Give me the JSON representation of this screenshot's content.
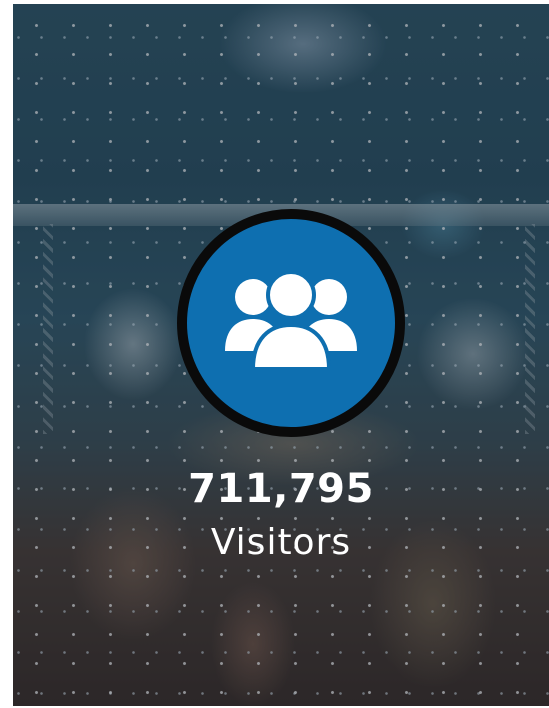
{
  "stat": {
    "value": "711,795",
    "label": "Visitors",
    "icon": "users-group-icon"
  },
  "colors": {
    "icon_circle": "#0e6fb0",
    "icon_border": "#0a0a0a",
    "text": "#ffffff",
    "overlay": "#0e1c2c"
  }
}
